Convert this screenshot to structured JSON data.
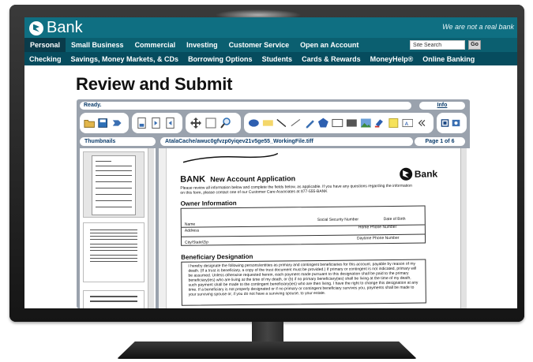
{
  "bank": {
    "logo_text": "Bank",
    "tagline": "We are not a real bank"
  },
  "nav_primary": {
    "items": [
      "Personal",
      "Small Business",
      "Commercial",
      "Investing",
      "Customer Service",
      "Open an Account"
    ],
    "active": "Personal",
    "search_value": "Site Search",
    "go_label": "Go"
  },
  "nav_secondary": {
    "items": [
      "Checking",
      "Savings, Money Markets, & CDs",
      "Borrowing Options",
      "Students",
      "Cards & Rewards",
      "MoneyHelp®",
      "Online Banking"
    ]
  },
  "page": {
    "title": "Review and Submit"
  },
  "viewer": {
    "status": "Ready.",
    "info_label": "Info",
    "thumbnails_label": "Thumbnails",
    "file_path": "AtalaCache/awuc0gfvzp0yiqev21v5ge55_WorkingFile.tiff",
    "page_indicator": "Page 1 of 6",
    "toolbar_icons": {
      "file": [
        "open-folder-icon",
        "save-icon",
        "forward-icon"
      ],
      "pages": [
        "page-icon",
        "page-prev-icon",
        "page-next-icon"
      ],
      "view": [
        "pan-icon",
        "select-rect-icon",
        "zoom-icon"
      ],
      "annotations": [
        "ellipse-icon",
        "highlight-icon",
        "line-icon",
        "freehand-icon",
        "pen-icon",
        "polygon-icon",
        "rectangle-icon",
        "filled-rect-icon",
        "image-icon",
        "stamp-icon",
        "sticky-note-icon",
        "text-icon",
        "collapse-icon"
      ],
      "extra": [
        "fit-page-icon",
        "properties-icon"
      ]
    }
  },
  "document": {
    "brand": "BANK",
    "title": "New Account Application",
    "logo_text": "Bank",
    "instructions": "Please review all information below and complete the fields below, as applicable. If you have any questions regarding the information on this form, please contact one of our Customer Care Associates at 877-555-BANK",
    "owner_section": "Owner Information",
    "fields": {
      "name": "Name",
      "ssn": "Social Security Number",
      "dob": "Date of Birth",
      "home_phone": "Home Phone Number",
      "address": "Address",
      "city": "City/State/Zip",
      "day_phone": "Daytime Phone Number"
    },
    "beneficiary_section": "Beneficiary Designation",
    "beneficiary_text": "I hereby designate the following persons/entities as primary and contingent beneficiaries for this account, payable by reason of my death. (If a trust is beneficiary, a copy of the trust document must be provided.) If primary or contingent is not indicated, primary will be assumed. Unless otherwise requested herein, each payment made pursuant to this designation shall be paid to the primary beneficiary(ies) who are living at the time of my death, or (b) if no primary beneficiary(ies) shall be living at the time of my death, such payment shall be made to the contingent beneficiary(ies) who are then living. I have the right to change this designation at any time. If a beneficiary is not properly designated or if no primary or contingent beneficiary survives you, payments shall be made to your surviving spouse or, if you do not have a surviving spouse, to your estate."
  },
  "colors": {
    "header": "#0f6f82",
    "nav_primary": "#0b5f70",
    "nav_active": "#0a3b4a",
    "nav_secondary": "#064c5e",
    "viewer_frame": "#9aa2ad"
  }
}
